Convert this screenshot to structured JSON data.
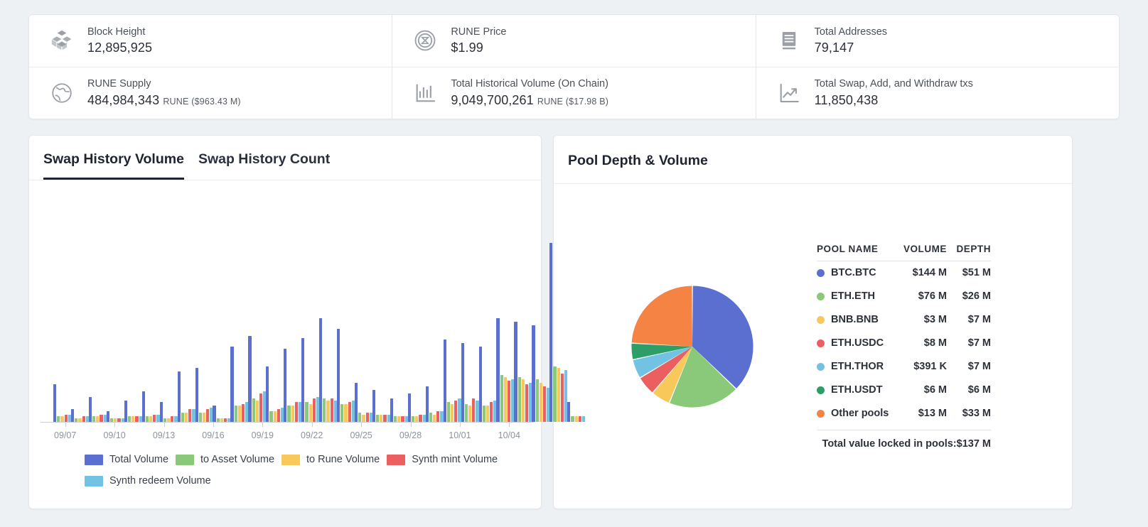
{
  "stats": {
    "columns": [
      {
        "rows": [
          {
            "icon": "cubes-icon",
            "label": "Block Height",
            "value": "12,895,925",
            "unit": ""
          },
          {
            "icon": "globe-icon",
            "label": "RUNE Supply",
            "value": "484,984,343",
            "unit": "RUNE ($963.43 M)"
          }
        ]
      },
      {
        "rows": [
          {
            "icon": "rune-coin-icon",
            "label": "RUNE Price",
            "value": "$1.99",
            "unit": ""
          },
          {
            "icon": "bar-chart-icon",
            "label": "Total Historical Volume (On Chain)",
            "value": "9,049,700,261",
            "unit": "RUNE ($17.98 B)"
          }
        ]
      },
      {
        "rows": [
          {
            "icon": "book-icon",
            "label": "Total Addresses",
            "value": "79,147",
            "unit": ""
          },
          {
            "icon": "trend-up-icon",
            "label": "Total Swap, Add, and Withdraw txs",
            "value": "11,850,438",
            "unit": ""
          }
        ]
      }
    ]
  },
  "swap_panel": {
    "tabs": [
      {
        "label": "Swap History Volume",
        "active": true
      },
      {
        "label": "Swap History Count",
        "active": false
      }
    ]
  },
  "pool_panel": {
    "title": "Pool Depth & Volume",
    "headers": {
      "name": "POOL NAME",
      "volume": "VOLUME",
      "depth": "DEPTH"
    },
    "total_label": "Total value locked in pools:",
    "total_value": "$137 M",
    "rows": [
      {
        "name": "BTC.BTC",
        "volume": "$144 M",
        "depth": "$51 M",
        "color": "#5a6fd0"
      },
      {
        "name": "ETH.ETH",
        "volume": "$76 M",
        "depth": "$26 M",
        "color": "#8bc97a"
      },
      {
        "name": "BNB.BNB",
        "volume": "$3 M",
        "depth": "$7 M",
        "color": "#f8c95a"
      },
      {
        "name": "ETH.USDC",
        "volume": "$8 M",
        "depth": "$7 M",
        "color": "#ec5f60"
      },
      {
        "name": "ETH.THOR",
        "volume": "$391 K",
        "depth": "$7 M",
        "color": "#72c2e3"
      },
      {
        "name": "ETH.USDT",
        "volume": "$6 M",
        "depth": "$6 M",
        "color": "#2e9e67"
      },
      {
        "name": "Other pools",
        "volume": "$13 M",
        "depth": "$33 M",
        "color": "#f58344"
      }
    ]
  },
  "chart_data": [
    {
      "type": "pie",
      "title": "Pool Depth & Volume",
      "labels": [
        "BTC.BTC",
        "ETH.ETH",
        "BNB.BNB",
        "ETH.USDC",
        "ETH.THOR",
        "ETH.USDT",
        "Other pools"
      ],
      "values": [
        51,
        26,
        7,
        7,
        7,
        6,
        33
      ],
      "unit": "USD millions (depth)",
      "colors": [
        "#5a6fd0",
        "#8bc97a",
        "#f8c95a",
        "#ec5f60",
        "#72c2e3",
        "#2e9e67",
        "#f58344"
      ],
      "legend": "right",
      "total": 137
    },
    {
      "type": "bar",
      "title": "Swap History Volume",
      "xlabel": "",
      "ylabel": "",
      "grid": false,
      "legend": "bottom",
      "legend_entries": [
        {
          "name": "Total Volume",
          "color": "#5a6fd0"
        },
        {
          "name": "to Asset Volume",
          "color": "#8bc97a"
        },
        {
          "name": "to Rune Volume",
          "color": "#f8c95a"
        },
        {
          "name": "Synth mint Volume",
          "color": "#ec5f60"
        },
        {
          "name": "Synth redeem Volume",
          "color": "#72c2e3"
        }
      ],
      "tick_labels": [
        "09/07",
        "09/10",
        "09/13",
        "09/16",
        "09/19",
        "09/22",
        "09/25",
        "09/28",
        "10/01",
        "10/04"
      ],
      "categories": [
        "09/06",
        "09/07",
        "09/08",
        "09/09",
        "09/10",
        "09/11",
        "09/12",
        "09/13",
        "09/14",
        "09/15",
        "09/16",
        "09/17",
        "09/18",
        "09/19",
        "09/20",
        "09/21",
        "09/22",
        "09/23",
        "09/24",
        "09/25",
        "09/26",
        "09/27",
        "09/28",
        "09/29",
        "09/30",
        "10/01",
        "10/02",
        "10/03",
        "10/04",
        "10/05"
      ],
      "series": [
        {
          "name": "Total Volume",
          "color": "#5a6fd0",
          "values": [
            21,
            7,
            14,
            6,
            12,
            17,
            11,
            28,
            30,
            9,
            42,
            48,
            31,
            41,
            47,
            58,
            52,
            22,
            18,
            13,
            16,
            20,
            46,
            44,
            42,
            58,
            56,
            54,
            100,
            11
          ]
        },
        {
          "name": "to Asset Volume",
          "color": "#8bc97a",
          "values": [
            3,
            2,
            3,
            2,
            3,
            3,
            2,
            5,
            5,
            2,
            9,
            13,
            6,
            9,
            11,
            13,
            10,
            5,
            4,
            3,
            3,
            5,
            11,
            10,
            9,
            26,
            25,
            24,
            31,
            3
          ]
        },
        {
          "name": "to Rune Volume",
          "color": "#f8c95a",
          "values": [
            3,
            2,
            3,
            2,
            3,
            3,
            2,
            5,
            5,
            2,
            9,
            12,
            6,
            9,
            10,
            12,
            10,
            4,
            4,
            3,
            3,
            4,
            10,
            9,
            9,
            25,
            24,
            22,
            30,
            3
          ]
        },
        {
          "name": "Synth mint Volume",
          "color": "#ec5f60",
          "values": [
            4,
            3,
            4,
            2,
            3,
            4,
            3,
            7,
            7,
            2,
            10,
            16,
            7,
            11,
            13,
            13,
            11,
            5,
            4,
            3,
            4,
            6,
            12,
            13,
            11,
            23,
            21,
            20,
            27,
            3
          ]
        },
        {
          "name": "Synth redeem Volume",
          "color": "#72c2e3",
          "values": [
            4,
            3,
            4,
            2,
            3,
            4,
            3,
            7,
            8,
            2,
            11,
            17,
            8,
            11,
            14,
            12,
            12,
            5,
            4,
            3,
            4,
            6,
            13,
            12,
            12,
            24,
            22,
            19,
            29,
            3
          ]
        }
      ],
      "ylim": [
        0,
        100
      ]
    }
  ]
}
